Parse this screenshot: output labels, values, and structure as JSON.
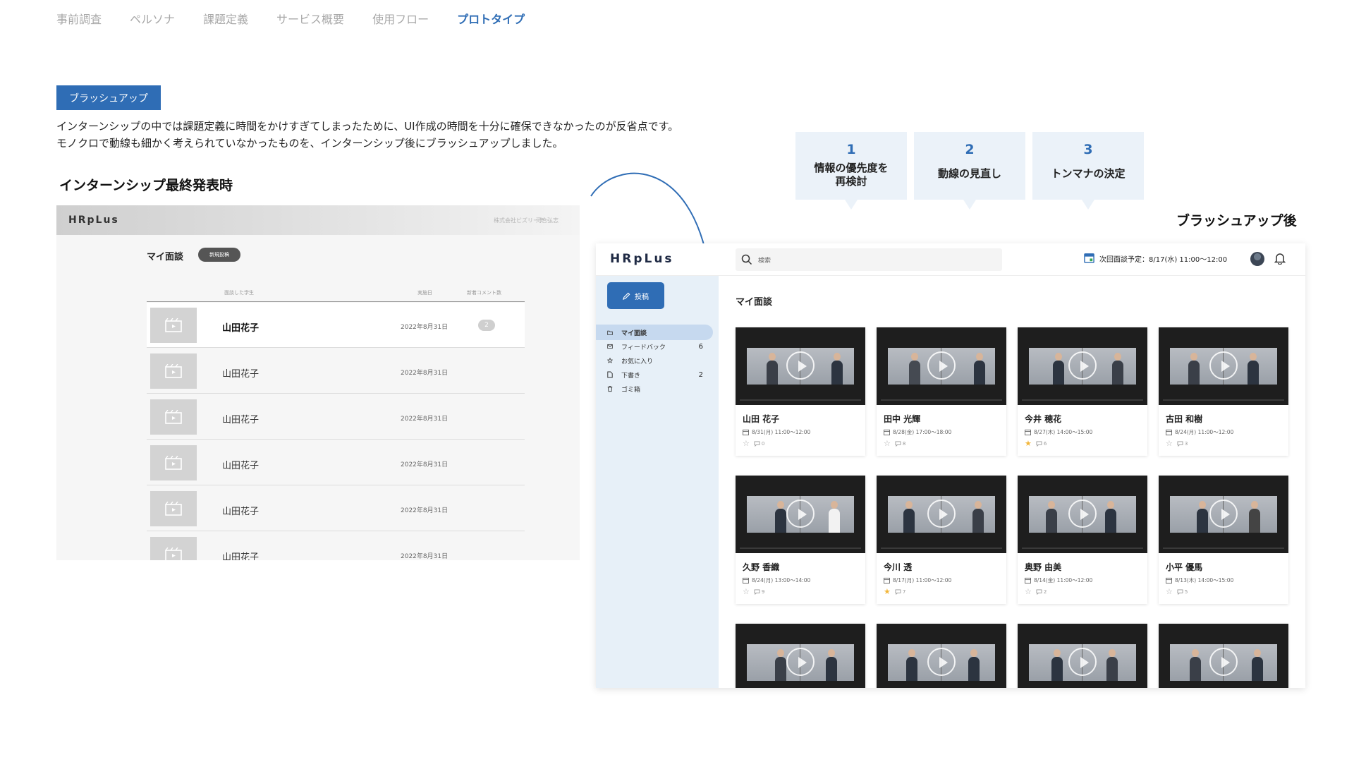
{
  "nav": [
    {
      "label": "事前調査",
      "active": false
    },
    {
      "label": "ペルソナ",
      "active": false
    },
    {
      "label": "課題定義",
      "active": false
    },
    {
      "label": "サービス概要",
      "active": false
    },
    {
      "label": "使用フロー",
      "active": false
    },
    {
      "label": "プロトタイプ",
      "active": true
    }
  ],
  "badge": "ブラッシュアップ",
  "description": [
    "インターンシップの中では課題定義に時間をかけすぎてしまったために、UI作成の時間を十分に確保できなかったのが反省点です。",
    "モノクロで動線も細かく考えられていなかったものを、インターンシップ後にブラッシュアップしました。"
  ],
  "before_title": "インターンシップ最終発表時",
  "after_title": "ブラッシュアップ後",
  "steps": [
    {
      "num": "1",
      "line1": "情報の優先度を",
      "line2": "再検討"
    },
    {
      "num": "2",
      "line1": "動線の見直し",
      "line2": ""
    },
    {
      "num": "3",
      "line1": "トンマナの決定",
      "line2": ""
    }
  ],
  "before": {
    "logo": "HRpLus",
    "company": "株式会社ビズリーチ",
    "user": "河合弘志",
    "title": "マイ面談",
    "new_button": "新規投稿",
    "headers": {
      "student": "面談した学生",
      "date": "実施日",
      "comments": "新着コメント数"
    },
    "rows": [
      {
        "name": "山田花子",
        "date": "2022年8月31日",
        "count": "2"
      },
      {
        "name": "山田花子",
        "date": "2022年8月31日",
        "count": ""
      },
      {
        "name": "山田花子",
        "date": "2022年8月31日",
        "count": ""
      },
      {
        "name": "山田花子",
        "date": "2022年8月31日",
        "count": ""
      },
      {
        "name": "山田花子",
        "date": "2022年8月31日",
        "count": ""
      },
      {
        "name": "山田花子",
        "date": "2022年8月31日",
        "count": ""
      }
    ]
  },
  "after": {
    "logo": "HRpLus",
    "search_placeholder": "検索",
    "next_meeting": "次回面談予定：8/17(水) 11:00〜12:00",
    "post_button": "投稿",
    "sidebar": [
      {
        "label": "マイ面談",
        "count": "",
        "icon": "folder-icon",
        "active": true
      },
      {
        "label": "フィードバック",
        "count": "6",
        "icon": "mail-icon",
        "active": false
      },
      {
        "label": "お気に入り",
        "count": "",
        "icon": "star-icon",
        "active": false
      },
      {
        "label": "下書き",
        "count": "2",
        "icon": "document-icon",
        "active": false
      },
      {
        "label": "ゴミ箱",
        "count": "",
        "icon": "trash-icon",
        "active": false
      }
    ],
    "section_title": "マイ面談",
    "cards": [
      {
        "name": "山田 花子",
        "date": "8/31(月) 11:00〜12:00",
        "starred": false,
        "comments": "0"
      },
      {
        "name": "田中 光輝",
        "date": "8/28(金) 17:00〜18:00",
        "starred": false,
        "comments": "8"
      },
      {
        "name": "今井 穂花",
        "date": "8/27(木) 14:00〜15:00",
        "starred": true,
        "comments": "6"
      },
      {
        "name": "古田 和樹",
        "date": "8/24(月) 11:00〜12:00",
        "starred": false,
        "comments": "3"
      },
      {
        "name": "久野 香織",
        "date": "8/24(月) 13:00〜14:00",
        "starred": false,
        "comments": "9"
      },
      {
        "name": "今川 透",
        "date": "8/17(月) 11:00〜12:00",
        "starred": true,
        "comments": "7"
      },
      {
        "name": "奥野 由美",
        "date": "8/14(金) 11:00〜12:00",
        "starred": false,
        "comments": "2"
      },
      {
        "name": "小平 優馬",
        "date": "8/13(木) 14:00〜15:00",
        "starred": false,
        "comments": "5"
      },
      {
        "name": "",
        "date": "",
        "starred": false,
        "comments": ""
      },
      {
        "name": "",
        "date": "",
        "starred": false,
        "comments": ""
      },
      {
        "name": "",
        "date": "",
        "starred": false,
        "comments": ""
      },
      {
        "name": "",
        "date": "",
        "starred": false,
        "comments": ""
      }
    ]
  },
  "colors": {
    "accent": "#2f6db5",
    "sidebar_bg": "#e7f0f8",
    "step_bg": "#ebf2f9",
    "highlight": "#d7efe9",
    "star_on": "#f2b63a"
  }
}
